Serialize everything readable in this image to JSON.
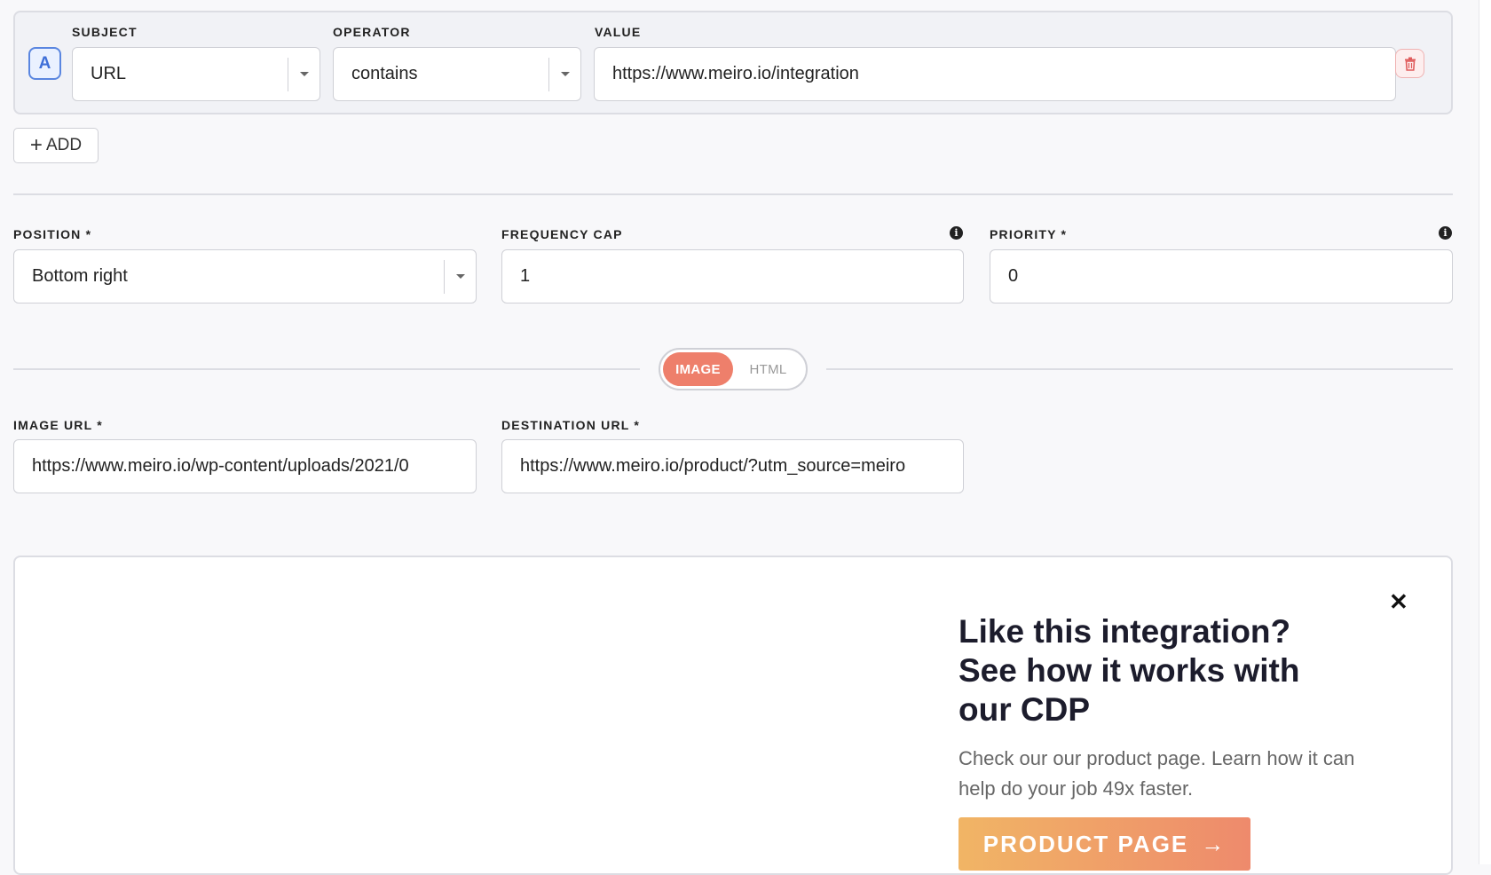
{
  "condition": {
    "letter": "A",
    "subject": {
      "label": "SUBJECT",
      "value": "URL"
    },
    "operator": {
      "label": "OPERATOR",
      "value": "contains"
    },
    "value": {
      "label": "VALUE",
      "value": "https://www.meiro.io/integration"
    }
  },
  "add_button": {
    "label": "ADD"
  },
  "position": {
    "label": "POSITION *",
    "value": "Bottom right"
  },
  "frequency_cap": {
    "label": "FREQUENCY CAP",
    "value": "1"
  },
  "priority": {
    "label": "PRIORITY *",
    "value": "0"
  },
  "content_toggle": {
    "options": [
      "IMAGE",
      "HTML"
    ],
    "selected": "IMAGE"
  },
  "image_url": {
    "label": "IMAGE URL *",
    "value": "https://www.meiro.io/wp-content/uploads/2021/0"
  },
  "destination_url": {
    "label": "DESTINATION URL *",
    "value": "https://www.meiro.io/product/?utm_source=meiro"
  },
  "preview": {
    "close_glyph": "✕",
    "title": "Like this integration? See how it works with our CDP",
    "text": "Check our our product page. Learn how it can help do your job 49x faster.",
    "button_label": "PRODUCT PAGE",
    "button_arrow": "→"
  },
  "icons": {
    "trash": "trash-icon",
    "info": "info-icon",
    "caret": "chevron-down-icon",
    "close": "close-icon",
    "plus": "plus-icon",
    "arrow": "arrow-right-icon"
  },
  "colors": {
    "accent": "#ee7f6b",
    "badge_blue": "#3f6fd8",
    "danger": "#e05c5c",
    "cta_gradient_start": "#f1b565",
    "cta_gradient_end": "#ee8a6c"
  }
}
